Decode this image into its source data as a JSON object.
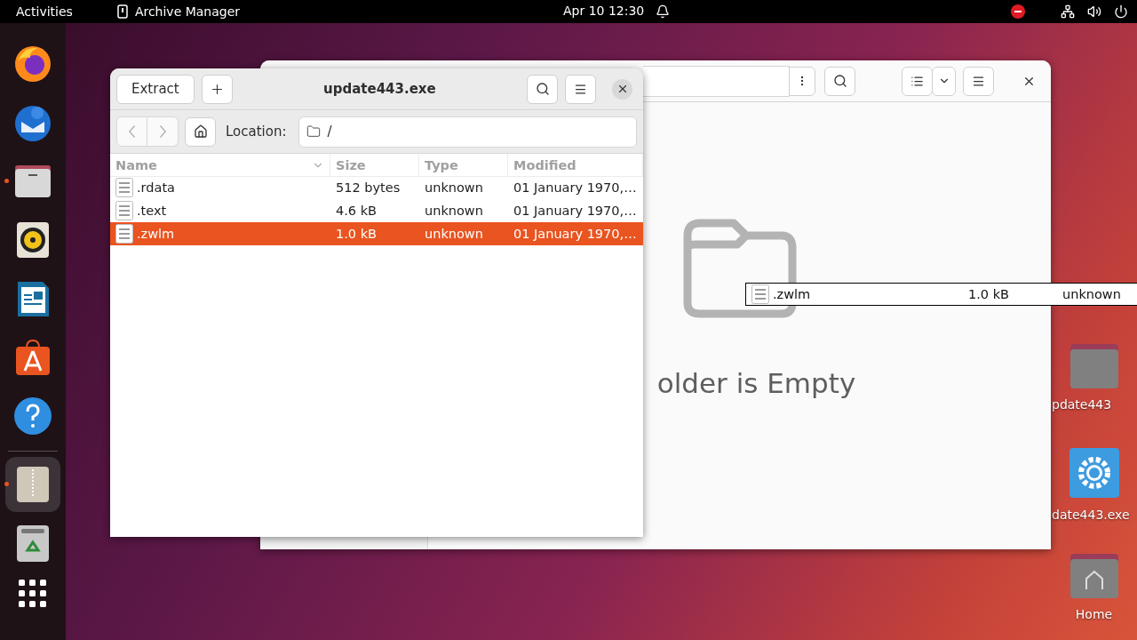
{
  "top_bar": {
    "activities": "Activities",
    "app_name": "Archive Manager",
    "clock": "Apr 10  12:30"
  },
  "dock": {
    "items": [
      {
        "kind": "browser",
        "running": false,
        "selected": false
      },
      {
        "kind": "mail",
        "running": false,
        "selected": false
      },
      {
        "kind": "files",
        "running": true,
        "selected": false
      },
      {
        "kind": "music",
        "running": false,
        "selected": false
      },
      {
        "kind": "writer",
        "running": false,
        "selected": false
      },
      {
        "kind": "store",
        "running": false,
        "selected": false
      },
      {
        "kind": "help",
        "running": false,
        "selected": false
      },
      {
        "kind": "archive",
        "running": true,
        "selected": true
      },
      {
        "kind": "trash",
        "running": false,
        "selected": false
      }
    ]
  },
  "files_window": {
    "empty_message": "older is Empty"
  },
  "archive_window": {
    "title": "update443.exe",
    "extract_label": "Extract",
    "location_label": "Location:",
    "location_value": "/",
    "columns": [
      "Name",
      "Size",
      "Type",
      "Modified"
    ],
    "rows": [
      {
        "name": ".rdata",
        "size": "512 bytes",
        "type": "unknown",
        "modified": "01 January 1970,…",
        "selected": false
      },
      {
        "name": ".text",
        "size": "4.6 kB",
        "type": "unknown",
        "modified": "01 January 1970,…",
        "selected": false
      },
      {
        "name": ".zwlm",
        "size": "1.0 kB",
        "type": "unknown",
        "modified": "01 January 1970,…",
        "selected": true
      }
    ]
  },
  "drag_item": {
    "name": ".zwlm",
    "size": "1.0 kB",
    "type": "unknown"
  },
  "desktop_icons": [
    {
      "kind": "folder",
      "label": "pdate443"
    },
    {
      "kind": "executable",
      "label": "date443.exe"
    },
    {
      "kind": "home",
      "label": "Home"
    }
  ]
}
